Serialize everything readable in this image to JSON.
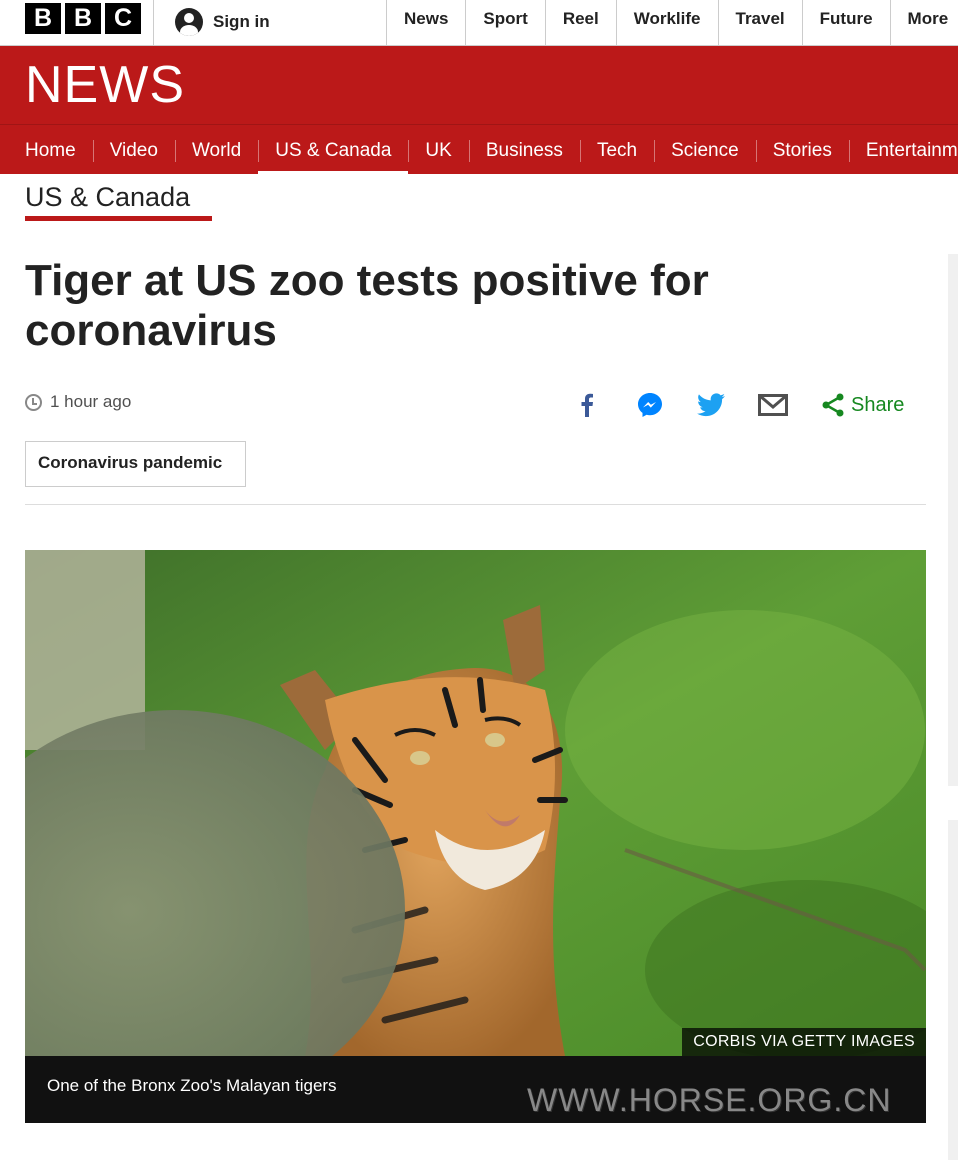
{
  "topbar": {
    "logo_letters": [
      "B",
      "B",
      "C"
    ],
    "signin_label": "Sign in",
    "nav": [
      "News",
      "Sport",
      "Reel",
      "Worklife",
      "Travel",
      "Future",
      "More"
    ]
  },
  "banner": {
    "wordmark": "NEWS",
    "color": "#bb1919"
  },
  "section_nav": {
    "items": [
      "Home",
      "Video",
      "World",
      "US & Canada",
      "UK",
      "Business",
      "Tech",
      "Science",
      "Stories",
      "Entertainment & Arts"
    ],
    "active": "US & Canada"
  },
  "subsection": {
    "title": "US & Canada"
  },
  "article": {
    "headline": "Tiger at US zoo tests positive for coronavirus",
    "timestamp": "1 hour ago",
    "share_label": "Share",
    "share_icons": [
      "facebook-icon",
      "messenger-icon",
      "twitter-icon",
      "email-icon",
      "share-icon"
    ],
    "tag": "Coronavirus pandemic",
    "image": {
      "copyright": "CORBIS VIA GETTY IMAGES",
      "caption": "One of the Bronx Zoo's Malayan tigers",
      "watermark": "WWW.HORSE.ORG.CN"
    }
  },
  "colors": {
    "accent": "#bb1919",
    "share_green": "#168820",
    "facebook": "#3b5998",
    "messenger": "#0084ff",
    "twitter": "#1da1f2"
  }
}
